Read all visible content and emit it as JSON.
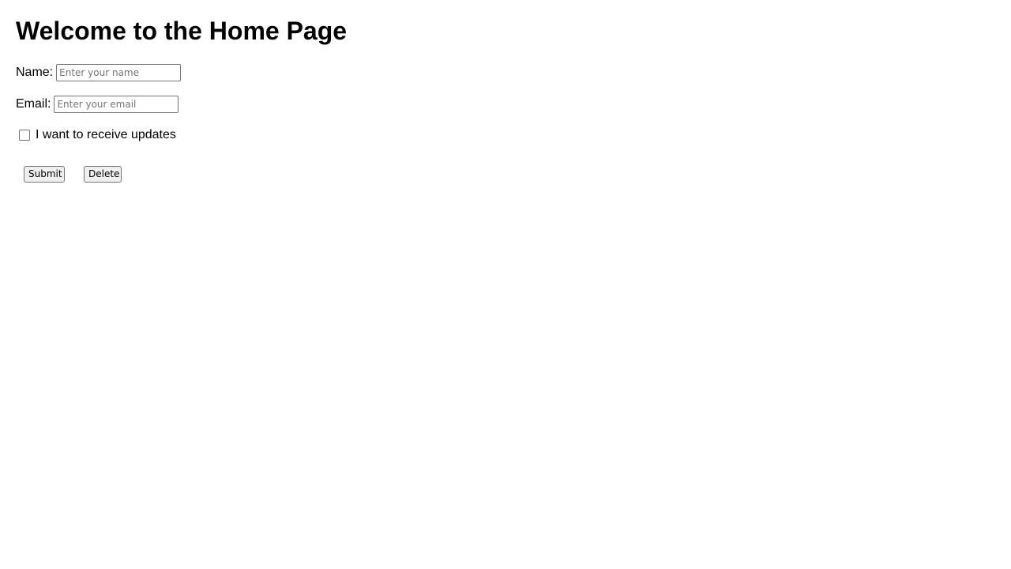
{
  "page": {
    "title": "Welcome to the Home Page"
  },
  "form": {
    "name_label": "Name:",
    "name_placeholder": "Enter your name",
    "name_value": "",
    "email_label": "Email:",
    "email_placeholder": "Enter your email",
    "email_value": "",
    "updates_label": "I want to receive updates",
    "updates_checked": false
  },
  "actions": {
    "submit_label": "Submit",
    "delete_label": "Delete"
  }
}
